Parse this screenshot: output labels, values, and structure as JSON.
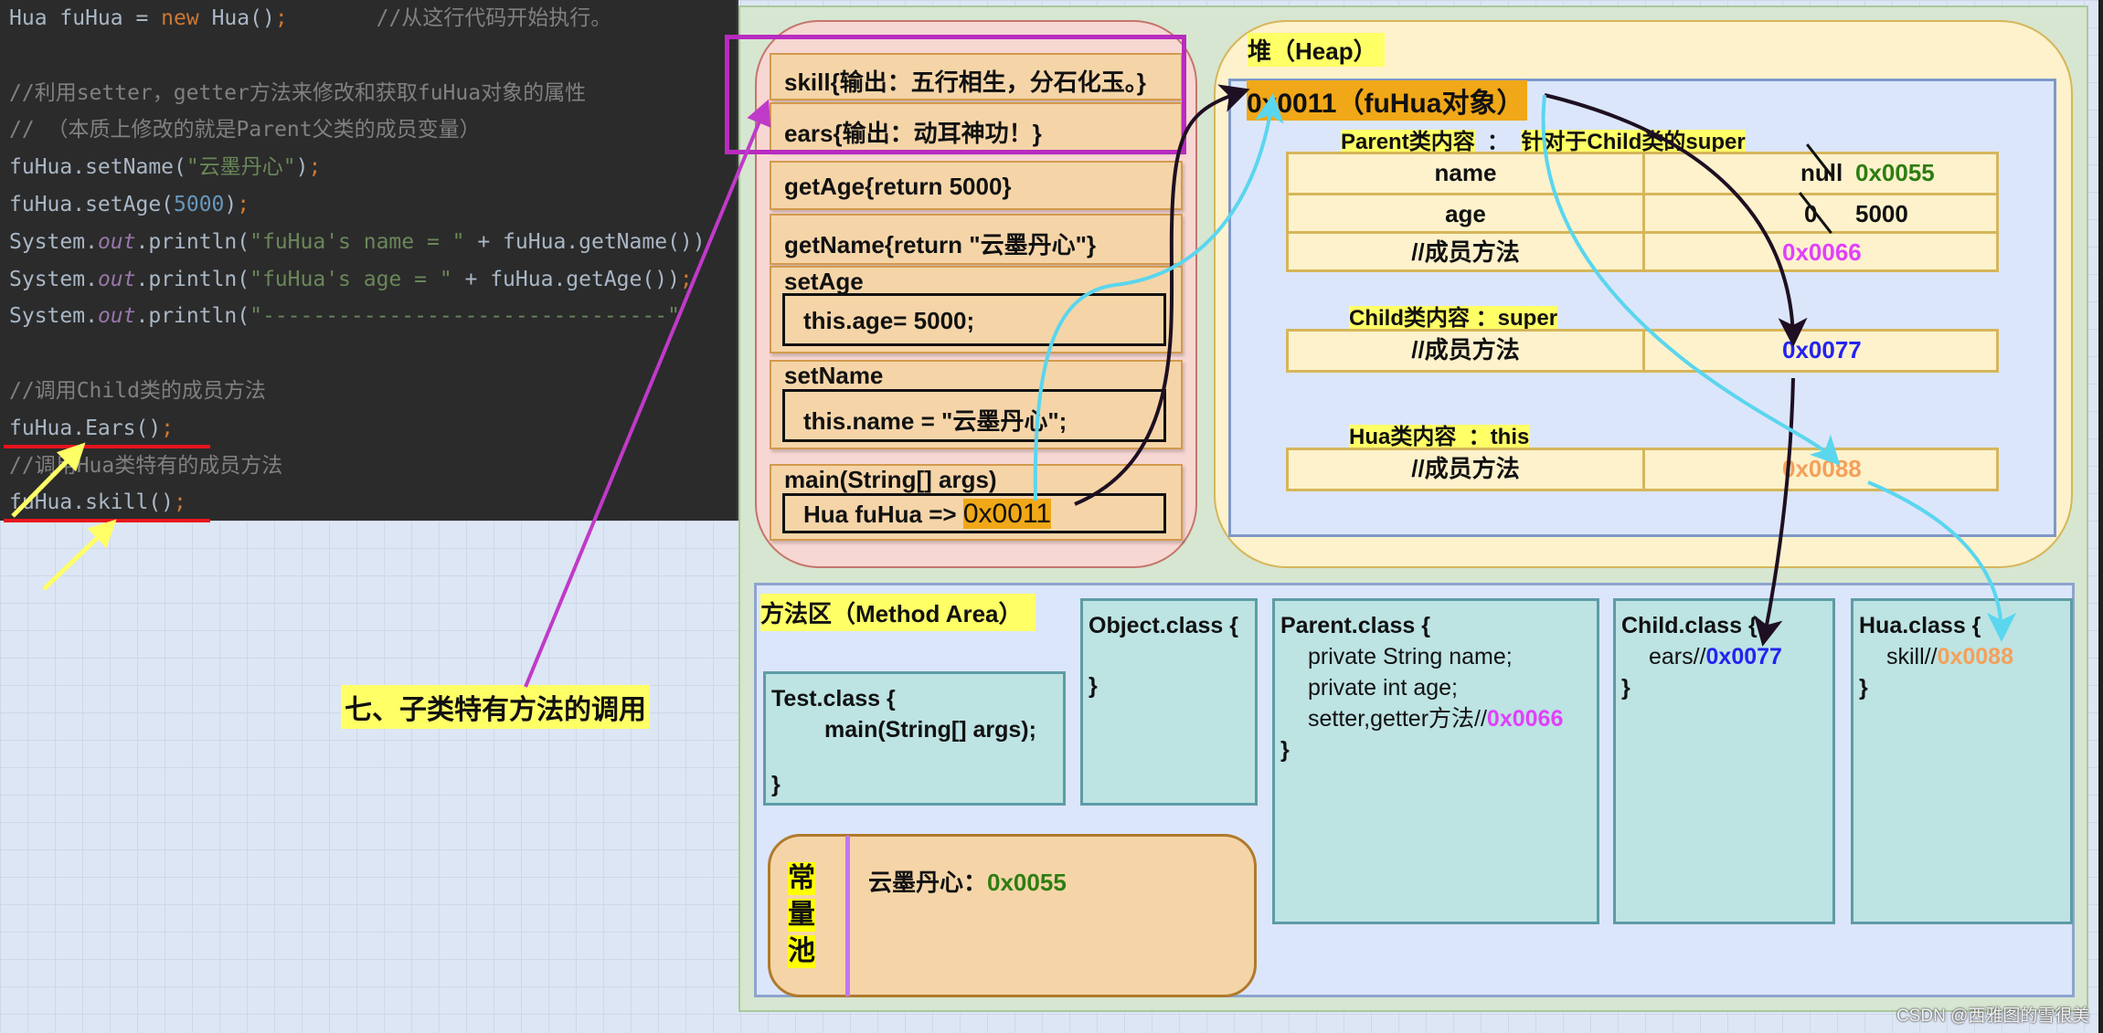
{
  "editor": {
    "lines": [
      {
        "parts": [
          {
            "t": "Hua fuHua = ",
            "c": ""
          },
          {
            "t": "new",
            "c": "c-kw"
          },
          {
            "t": " Hua()",
            "c": ""
          },
          {
            "t": ";",
            "c": "c-semi"
          },
          {
            "t": "       //从这行代码开始执行。",
            "c": "c-cmt"
          }
        ]
      },
      {
        "parts": []
      },
      {
        "parts": [
          {
            "t": "//利用setter，getter方法来修改和获取fuHua对象的属性",
            "c": "c-cmt"
          }
        ]
      },
      {
        "parts": [
          {
            "t": "// （本质上修改的就是Parent父类的成员变量）",
            "c": "c-cmt"
          }
        ]
      },
      {
        "parts": [
          {
            "t": "fuHua.setName(",
            "c": ""
          },
          {
            "t": "\"云墨丹心\"",
            "c": "c-str"
          },
          {
            "t": ")",
            "c": ""
          },
          {
            "t": ";",
            "c": "c-semi"
          }
        ]
      },
      {
        "parts": [
          {
            "t": "fuHua.setAge(",
            "c": ""
          },
          {
            "t": "5000",
            "c": "c-num"
          },
          {
            "t": ")",
            "c": ""
          },
          {
            "t": ";",
            "c": "c-semi"
          }
        ]
      },
      {
        "parts": [
          {
            "t": "System.",
            "c": ""
          },
          {
            "t": "out",
            "c": "c-out"
          },
          {
            "t": ".println(",
            "c": ""
          },
          {
            "t": "\"fuHua's name = \"",
            "c": "c-str"
          },
          {
            "t": " + fuHua.getName())",
            "c": ""
          }
        ]
      },
      {
        "parts": [
          {
            "t": "System.",
            "c": ""
          },
          {
            "t": "out",
            "c": "c-out"
          },
          {
            "t": ".println(",
            "c": ""
          },
          {
            "t": "\"fuHua's age = \"",
            "c": "c-str"
          },
          {
            "t": " + fuHua.getAge())",
            "c": ""
          },
          {
            "t": ";",
            "c": "c-semi"
          }
        ]
      },
      {
        "parts": [
          {
            "t": "System.",
            "c": ""
          },
          {
            "t": "out",
            "c": "c-out"
          },
          {
            "t": ".println(",
            "c": ""
          },
          {
            "t": "\"--------------------------------\"",
            "c": "c-str"
          }
        ]
      },
      {
        "parts": []
      },
      {
        "parts": [
          {
            "t": "//调用Child类的成员方法",
            "c": "c-cmt"
          }
        ]
      },
      {
        "parts": [
          {
            "t": "fuHua.Ears()",
            "c": ""
          },
          {
            "t": ";",
            "c": "c-semi"
          }
        ]
      },
      {
        "parts": [
          {
            "t": "//调用Hua类特有的成员方法",
            "c": "c-cmt"
          }
        ]
      },
      {
        "parts": [
          {
            "t": "fuHua.skill()",
            "c": ""
          },
          {
            "t": ";",
            "c": "c-semi"
          }
        ]
      }
    ]
  },
  "section_title": "七、子类特有方法的调用",
  "stack": {
    "frames": {
      "skill": "skill{输出：五行相生，分石化玉。}",
      "ears": "ears{输出：动耳神功！}",
      "getAge": "getAge{return 5000}",
      "getName": "getName{return \"云墨丹心\"}",
      "setAge_title": "setAge",
      "setAge_body": "this.age= 5000;",
      "setName_title": "setName",
      "setName_body": "this.name = \"云墨丹心\";",
      "main_title": "main(String[] args)",
      "main_var": "Hua fuHua  => ",
      "main_addr": "0x0011"
    }
  },
  "heap": {
    "title": "堆（Heap）",
    "object_label": "0x0011（fuHua对象）",
    "parent_section": {
      "label": "Parent类内容",
      "sep": "  ：  ",
      "note": "针对于Child类的super"
    },
    "parent_rows": [
      {
        "name": "name",
        "old": "null",
        "value": "0x0055",
        "value_color": "#2e7d12"
      },
      {
        "name": "age",
        "old": "0",
        "value": "5000",
        "value_color": "#111111"
      },
      {
        "name": "//成员方法",
        "old": "",
        "value": "0x0066",
        "value_color": "#e040fb"
      }
    ],
    "child_section": {
      "label": "Child类内容",
      "sep": " ：",
      "note": "super"
    },
    "child_rows": [
      {
        "name": "//成员方法",
        "value": "0x0077",
        "value_color": "#2323f0"
      }
    ],
    "hua_section": {
      "label": "Hua类内容",
      "sep": "  ：",
      "note": "this"
    },
    "hua_rows": [
      {
        "name": "//成员方法",
        "value": "0x0088",
        "value_color": "#f4a05a"
      }
    ]
  },
  "method_area": {
    "title": "方法区（Method Area）",
    "test_class": {
      "header": "Test.class {",
      "body": "main(String[] args);",
      "close": "}"
    },
    "object_class": {
      "header": "Object.class {",
      "close": "}"
    },
    "parent_class": {
      "header": "Parent.class {",
      "field1": "private String name;",
      "field2": "private int age;",
      "methods": "setter,getter方法//",
      "methods_addr": "0x0066",
      "close": "}"
    },
    "child_class": {
      "header": "Child.class {",
      "method": "ears//",
      "method_addr": "0x0077",
      "close": "}"
    },
    "hua_class": {
      "header": "Hua.class {",
      "method": "skill//",
      "method_addr": "0x0088",
      "close": "}"
    },
    "constant_pool": {
      "label_chars": [
        "常",
        "量",
        "池"
      ],
      "entry_text": "云墨丹心：",
      "entry_addr": "0x0055"
    }
  },
  "colors": {
    "addr_green": "#2e7d12",
    "addr_magenta": "#e040fb",
    "addr_blue": "#2323f0",
    "addr_orange": "#f4a05a",
    "highlight_yellow": "#ffff66",
    "highlight_orange": "#f0a818",
    "callout_magenta": "#b82bc0"
  },
  "watermark": "CSDN @西雅图的雪很美"
}
